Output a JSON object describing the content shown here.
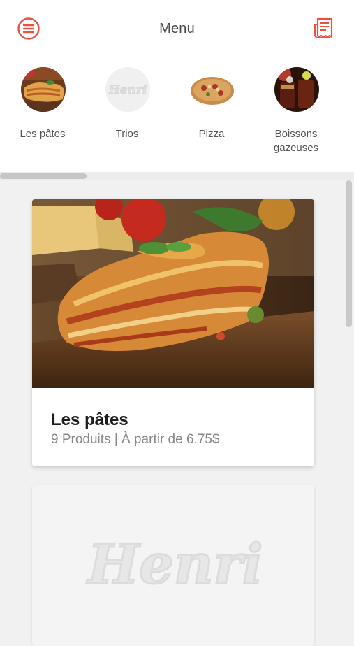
{
  "header": {
    "title": "Menu",
    "menu_icon": "hamburger-circle-icon",
    "receipt_icon": "receipt-icon",
    "accent_color": "#e8533f"
  },
  "categories": [
    {
      "label": "Les pâtes",
      "icon": "lasagna-photo"
    },
    {
      "label": "Trios",
      "icon": "henri-logo"
    },
    {
      "label": "Pizza",
      "icon": "pizza-photo"
    },
    {
      "label": "Boissons gazeuses",
      "icon": "soda-photo"
    }
  ],
  "cards": [
    {
      "name": "Les pâtes",
      "meta": "9 Produits | À partir de 6.75$",
      "image": "lasagna-photo"
    },
    {
      "watermark": "Henri"
    }
  ]
}
